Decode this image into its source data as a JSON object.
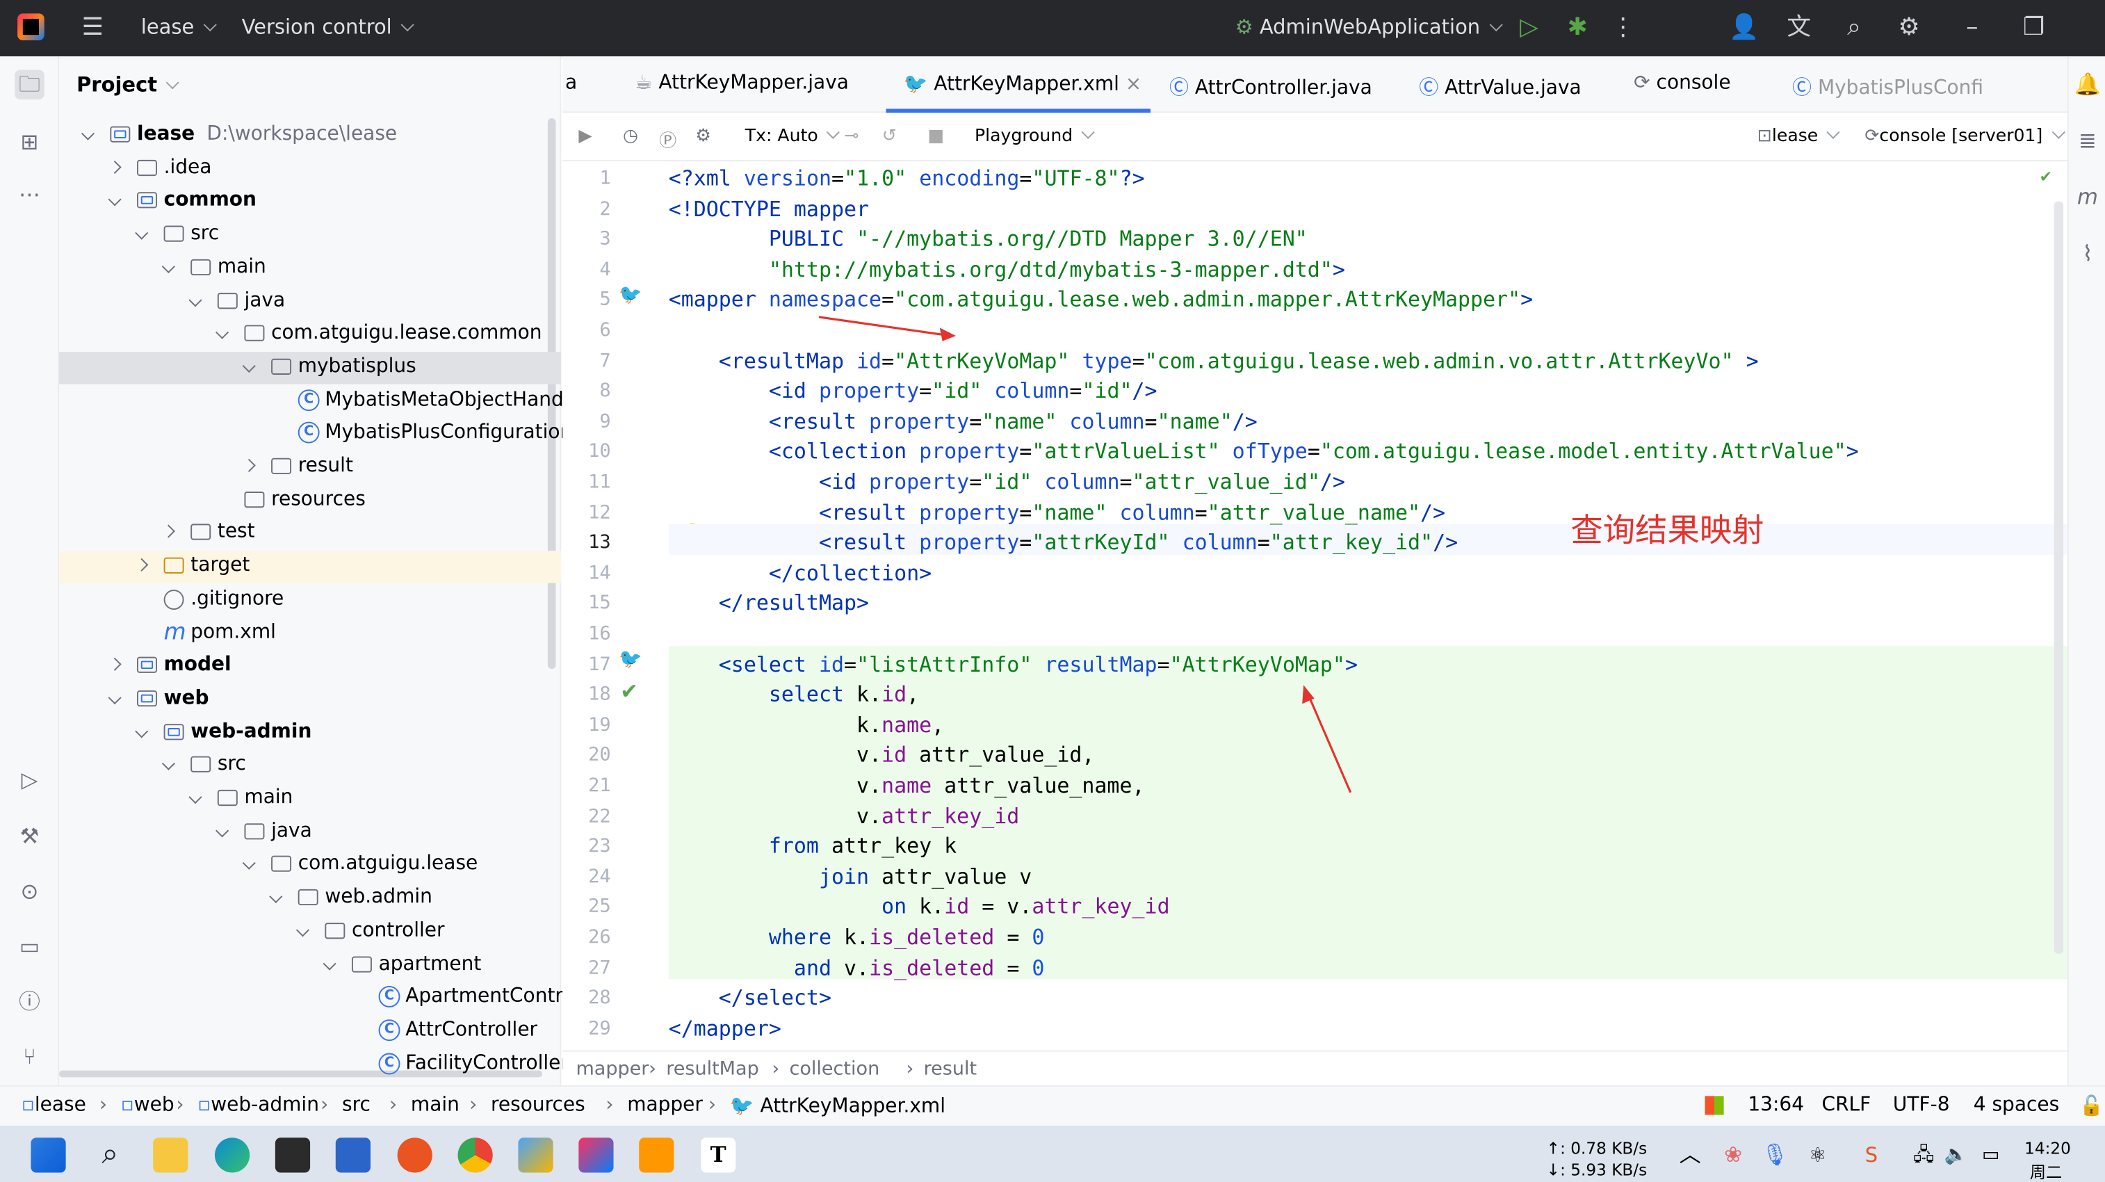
{
  "titlebar": {
    "project": "lease",
    "vcs": "Version control",
    "run_config": "AdminWebApplication"
  },
  "project_panel": {
    "title": "Project"
  },
  "tree": [
    {
      "label": "lease",
      "extra": "D:\\workspace\\lease",
      "level": 0,
      "open": true,
      "type": "module"
    },
    {
      "label": ".idea",
      "level": 1,
      "open": false,
      "type": "folder"
    },
    {
      "label": "common",
      "level": 1,
      "open": true,
      "type": "module"
    },
    {
      "label": "src",
      "level": 2,
      "open": true,
      "type": "folder"
    },
    {
      "label": "main",
      "level": 3,
      "open": true,
      "type": "folder"
    },
    {
      "label": "java",
      "level": 4,
      "open": true,
      "type": "folder"
    },
    {
      "label": "com.atguigu.lease.common",
      "level": 5,
      "open": true,
      "type": "package"
    },
    {
      "label": "mybatisplus",
      "level": 6,
      "open": true,
      "type": "package",
      "selected": true
    },
    {
      "label": "MybatisMetaObjectHandle",
      "level": 7,
      "type": "class"
    },
    {
      "label": "MybatisPlusConfiguration",
      "level": 7,
      "type": "class"
    },
    {
      "label": "result",
      "level": 6,
      "open": false,
      "type": "package"
    },
    {
      "label": "resources",
      "level": 5,
      "type": "folder"
    },
    {
      "label": "test",
      "level": 3,
      "open": false,
      "type": "folder"
    },
    {
      "label": "target",
      "level": 2,
      "open": false,
      "type": "target"
    },
    {
      "label": ".gitignore",
      "level": 2,
      "type": "ignore"
    },
    {
      "label": "pom.xml",
      "level": 2,
      "type": "maven"
    },
    {
      "label": "model",
      "level": 1,
      "open": false,
      "type": "module"
    },
    {
      "label": "web",
      "level": 1,
      "open": true,
      "type": "module"
    },
    {
      "label": "web-admin",
      "level": 2,
      "open": true,
      "type": "module"
    },
    {
      "label": "src",
      "level": 3,
      "open": true,
      "type": "folder"
    },
    {
      "label": "main",
      "level": 4,
      "open": true,
      "type": "folder"
    },
    {
      "label": "java",
      "level": 5,
      "open": true,
      "type": "folder"
    },
    {
      "label": "com.atguigu.lease",
      "level": 6,
      "open": true,
      "type": "package"
    },
    {
      "label": "web.admin",
      "level": 7,
      "open": true,
      "type": "package"
    },
    {
      "label": "controller",
      "level": 8,
      "open": true,
      "type": "package"
    },
    {
      "label": "apartment",
      "level": 9,
      "open": true,
      "type": "package"
    },
    {
      "label": "ApartmentControll",
      "level": 10,
      "type": "class"
    },
    {
      "label": "AttrController",
      "level": 10,
      "type": "class"
    },
    {
      "label": "FacilityController",
      "level": 10,
      "type": "class"
    }
  ],
  "tabs": [
    {
      "label": "a"
    },
    {
      "label": "AttrKeyMapper.java"
    },
    {
      "label": "AttrKeyMapper.xml",
      "active": true
    },
    {
      "label": "AttrController.java"
    },
    {
      "label": "AttrValue.java"
    },
    {
      "label": "console"
    },
    {
      "label": "MybatisPlusConfi"
    }
  ],
  "editor_toolbar": {
    "tx": "Tx: Auto",
    "mode": "Playground",
    "datasource": "lease",
    "console": "console [server01]"
  },
  "code": [
    [
      [
        "tg",
        "<?xml "
      ],
      [
        "at",
        "version"
      ],
      [
        "",
        "="
      ],
      [
        "av",
        "\"1.0\""
      ],
      [
        "at",
        " encoding"
      ],
      [
        "",
        "="
      ],
      [
        "av",
        "\"UTF-8\""
      ],
      [
        "tg",
        "?>"
      ]
    ],
    [
      [
        "tg",
        "<!DOCTYPE mapper"
      ]
    ],
    [
      [
        "",
        "        "
      ],
      [
        "tg",
        "PUBLIC "
      ],
      [
        "av",
        "\"-//mybatis.org//DTD Mapper 3.0//EN\""
      ]
    ],
    [
      [
        "",
        "        "
      ],
      [
        "av",
        "\"http://mybatis.org/dtd/mybatis-3-mapper.dtd\""
      ],
      [
        "tg",
        ">"
      ]
    ],
    [
      [
        "tg",
        "<mapper "
      ],
      [
        "at",
        "namespace"
      ],
      [
        "",
        "="
      ],
      [
        "av",
        "\"com.atguigu.lease.web.admin.mapper.AttrKeyMapper\""
      ],
      [
        "tg",
        ">"
      ]
    ],
    [
      [
        "",
        ""
      ]
    ],
    [
      [
        "",
        "    "
      ],
      [
        "tg",
        "<resultMap "
      ],
      [
        "at",
        "id"
      ],
      [
        "",
        "="
      ],
      [
        "av",
        "\"AttrKeyVoMap\""
      ],
      [
        "at",
        " type"
      ],
      [
        "",
        "="
      ],
      [
        "av",
        "\"com.atguigu.lease.web.admin.vo.attr.AttrKeyVo\""
      ],
      [
        "tg",
        " >"
      ]
    ],
    [
      [
        "",
        "        "
      ],
      [
        "tg",
        "<id "
      ],
      [
        "at",
        "property"
      ],
      [
        "",
        "="
      ],
      [
        "av",
        "\"id\""
      ],
      [
        "at",
        " column"
      ],
      [
        "",
        "="
      ],
      [
        "av",
        "\"id\""
      ],
      [
        "tg",
        "/>"
      ]
    ],
    [
      [
        "",
        "        "
      ],
      [
        "tg",
        "<result "
      ],
      [
        "at",
        "property"
      ],
      [
        "",
        "="
      ],
      [
        "av",
        "\"name\""
      ],
      [
        "at",
        " column"
      ],
      [
        "",
        "="
      ],
      [
        "av",
        "\"name\""
      ],
      [
        "tg",
        "/>"
      ]
    ],
    [
      [
        "",
        "        "
      ],
      [
        "tg",
        "<collection "
      ],
      [
        "at",
        "property"
      ],
      [
        "",
        "="
      ],
      [
        "av",
        "\"attrValueList\""
      ],
      [
        "at",
        " ofType"
      ],
      [
        "",
        "="
      ],
      [
        "av",
        "\"com.atguigu.lease.model.entity.AttrValue\""
      ],
      [
        "tg",
        ">"
      ]
    ],
    [
      [
        "",
        "            "
      ],
      [
        "tg",
        "<id "
      ],
      [
        "at",
        "property"
      ],
      [
        "",
        "="
      ],
      [
        "av",
        "\"id\""
      ],
      [
        "at",
        " column"
      ],
      [
        "",
        "="
      ],
      [
        "av",
        "\"attr_value_id\""
      ],
      [
        "tg",
        "/>"
      ]
    ],
    [
      [
        "",
        "            "
      ],
      [
        "tg",
        "<result "
      ],
      [
        "at",
        "property"
      ],
      [
        "",
        "="
      ],
      [
        "av",
        "\"name\""
      ],
      [
        "at",
        " column"
      ],
      [
        "",
        "="
      ],
      [
        "av",
        "\"attr_value_name\""
      ],
      [
        "tg",
        "/>"
      ]
    ],
    [
      [
        "",
        "            "
      ],
      [
        "tg",
        "<result "
      ],
      [
        "at",
        "property"
      ],
      [
        "",
        "="
      ],
      [
        "av",
        "\"attrKeyId\""
      ],
      [
        "at",
        " column"
      ],
      [
        "",
        "="
      ],
      [
        "av",
        "\"attr_key_id\""
      ],
      [
        "tg",
        "/>"
      ]
    ],
    [
      [
        "",
        "        "
      ],
      [
        "tg",
        "</collection>"
      ]
    ],
    [
      [
        "",
        "    "
      ],
      [
        "tg",
        "</resultMap>"
      ]
    ],
    [
      [
        "",
        ""
      ]
    ],
    [
      [
        "",
        "    "
      ],
      [
        "tg",
        "<select "
      ],
      [
        "at",
        "id"
      ],
      [
        "",
        "="
      ],
      [
        "av",
        "\"listAttrInfo\""
      ],
      [
        "at",
        " resultMap"
      ],
      [
        "",
        "="
      ],
      [
        "av",
        "\"AttrKeyVoMap\""
      ],
      [
        "tg",
        ">"
      ]
    ],
    [
      [
        "",
        "        "
      ],
      [
        "kw",
        "select "
      ],
      [
        "",
        "k."
      ],
      [
        "fd",
        "id"
      ],
      [
        "",
        ","
      ]
    ],
    [
      [
        "",
        "               k."
      ],
      [
        "fd",
        "name"
      ],
      [
        "",
        ","
      ]
    ],
    [
      [
        "",
        "               v."
      ],
      [
        "fd",
        "id"
      ],
      [
        "",
        " attr_value_id,"
      ]
    ],
    [
      [
        "",
        "               v."
      ],
      [
        "fd",
        "name"
      ],
      [
        "",
        " attr_value_name,"
      ]
    ],
    [
      [
        "",
        "               v."
      ],
      [
        "fd",
        "attr_key_id"
      ]
    ],
    [
      [
        "",
        "        "
      ],
      [
        "kw",
        "from "
      ],
      [
        "",
        "attr_key k"
      ]
    ],
    [
      [
        "",
        "            "
      ],
      [
        "kw",
        "join "
      ],
      [
        "",
        "attr_value v"
      ]
    ],
    [
      [
        "",
        "                 "
      ],
      [
        "kw",
        "on "
      ],
      [
        "",
        "k."
      ],
      [
        "fd",
        "id"
      ],
      [
        "",
        " = v."
      ],
      [
        "fd",
        "attr_key_id"
      ]
    ],
    [
      [
        "",
        "        "
      ],
      [
        "kw",
        "where "
      ],
      [
        "",
        "k."
      ],
      [
        "fd",
        "is_deleted"
      ],
      [
        "",
        " = "
      ],
      [
        "nm",
        "0"
      ]
    ],
    [
      [
        "",
        "          "
      ],
      [
        "kw",
        "and "
      ],
      [
        "",
        "v."
      ],
      [
        "fd",
        "is_deleted"
      ],
      [
        "",
        " = "
      ],
      [
        "nm",
        "0"
      ]
    ],
    [
      [
        "",
        "    "
      ],
      [
        "tg",
        "</select>"
      ]
    ],
    [
      [
        "tg",
        "</mapper>"
      ]
    ]
  ],
  "annotation": "查询结果映射",
  "breadcrumb": [
    "mapper",
    "resultMap",
    "collection",
    "result"
  ],
  "statusbar": {
    "path": [
      "lease",
      "web",
      "web-admin",
      "src",
      "main",
      "resources",
      "mapper",
      "AttrKeyMapper.xml"
    ],
    "position": "13:64",
    "line_sep": "CRLF",
    "encoding": "UTF-8",
    "indent": "4 spaces"
  },
  "taskbar": {
    "net_up": "↑: 0.78 KB/s",
    "net_down": "↓: 5.93 KB/s",
    "time": "14:20",
    "day": "周二"
  }
}
